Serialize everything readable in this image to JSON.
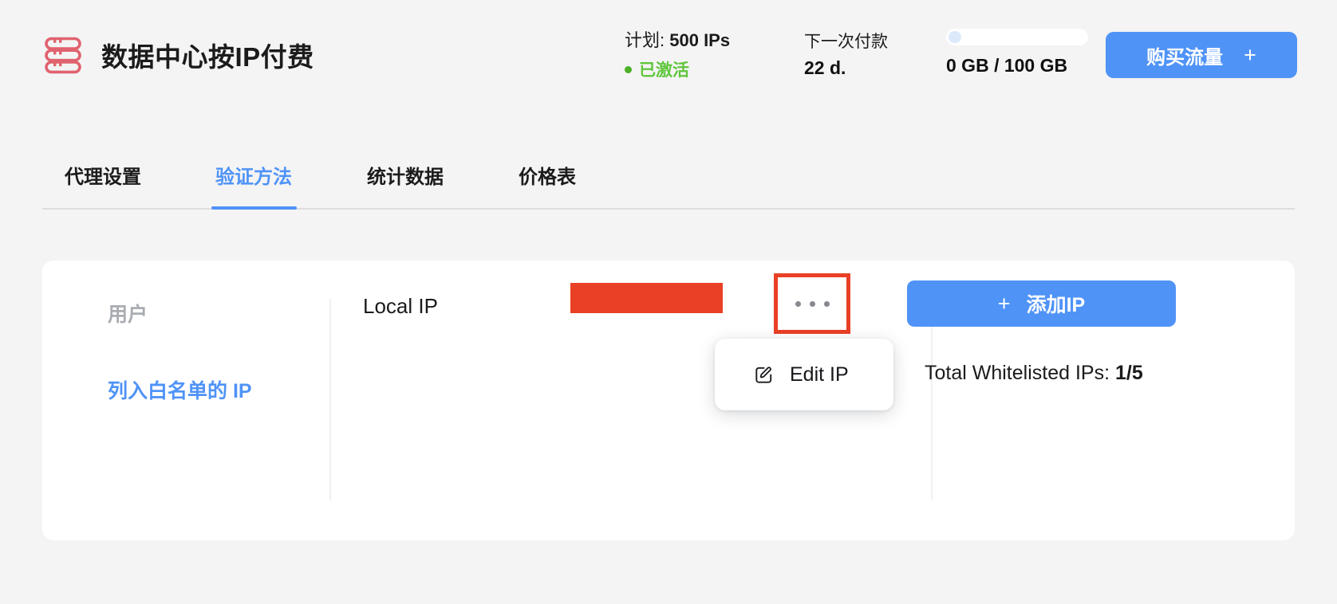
{
  "header": {
    "logo_icon": "server-stack-icon",
    "title": "数据中心按IP付费",
    "plan_label": "计划:",
    "plan_value": "500 IPs",
    "status_text": "已激活",
    "status_color": "#5fc63c",
    "payment_label": "下一次付款",
    "payment_value": "22 d.",
    "traffic_text": "0 GB / 100 GB",
    "traffic_used_gb": 0,
    "traffic_total_gb": 100,
    "buy_button_label": "购买流量",
    "buy_button_plus": "+",
    "accent_color": "#4f93f7"
  },
  "tabs": [
    {
      "label": "代理设置",
      "active": false
    },
    {
      "label": "验证方法",
      "active": true
    },
    {
      "label": "统计数据",
      "active": false
    },
    {
      "label": "价格表",
      "active": false
    }
  ],
  "card": {
    "side_nav": [
      {
        "label": "用户",
        "active": false
      },
      {
        "label": "列入白名单的 IP",
        "active": true
      }
    ],
    "row": {
      "ip_label": "Local IP",
      "ip_value_redacted": "",
      "menu_button_icon": "ellipsis-icon",
      "menu_dots": [
        "dot",
        "dot",
        "dot"
      ],
      "highlight_color": "#ea4026"
    },
    "dropdown": {
      "icon": "edit-square-icon",
      "label": "Edit IP"
    },
    "add_button": {
      "plus": "+",
      "label": "添加IP"
    },
    "total_label": "Total Whitelisted IPs:",
    "total_value": "1/5"
  }
}
